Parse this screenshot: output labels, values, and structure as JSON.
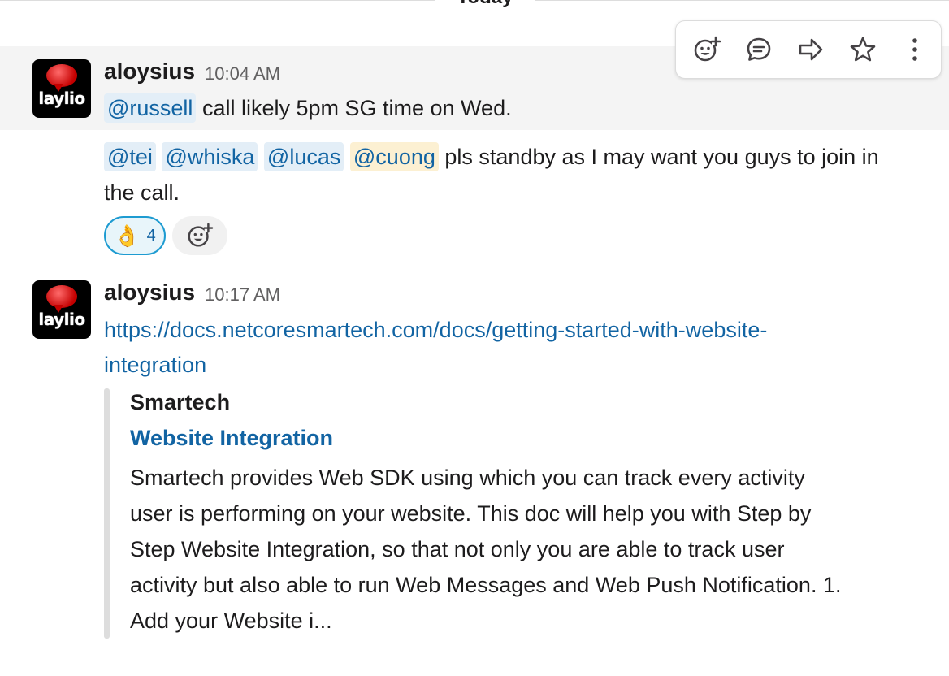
{
  "divider": {
    "label": "Today"
  },
  "toolbar": {
    "buttons": [
      {
        "name": "add-reaction",
        "icon": "emoji-add-icon"
      },
      {
        "name": "reply-in-thread",
        "icon": "comment-icon"
      },
      {
        "name": "share-message",
        "icon": "forward-arrow-icon"
      },
      {
        "name": "save-item",
        "icon": "star-icon"
      },
      {
        "name": "more-actions",
        "icon": "vertical-ellipsis-icon"
      }
    ]
  },
  "messages": [
    {
      "sender": "aloysius",
      "time": "10:04 AM",
      "avatar_text": "laylio",
      "line1": {
        "mention": "@russell",
        "text": "call likely 5pm SG time on Wed."
      },
      "line2": {
        "mentions": [
          "@tei",
          "@whiska",
          "@lucas",
          "@cuong"
        ],
        "text": "pls standby as I may want you guys to join in",
        "continuation": "the call."
      },
      "reactions": [
        {
          "emoji": "👌",
          "count": "4"
        }
      ]
    },
    {
      "sender": "aloysius",
      "time": "10:17 AM",
      "avatar_text": "laylio",
      "link_line1": "https://docs.netcoresmartech.com/docs/getting-started-with-website-",
      "link_line2": "integration",
      "unfurl": {
        "site": "Smartech",
        "title": "Website Integration",
        "description_lines": [
          "Smartech provides Web SDK using which you can track every activity",
          "user is performing on your website. This doc will help you with Step by",
          "Step Website Integration, so that not only you are able to track user",
          "activity but also able to run Web Messages and Web Push Notification. 1.",
          "Add your Website i..."
        ]
      }
    }
  ],
  "colors": {
    "link": "#1264a3",
    "mention_bg": "#e3eef7",
    "self_mention_bg": "#fcf0d2",
    "reaction_border": "#1d9bd1",
    "hover_bg": "#f4f4f4"
  }
}
